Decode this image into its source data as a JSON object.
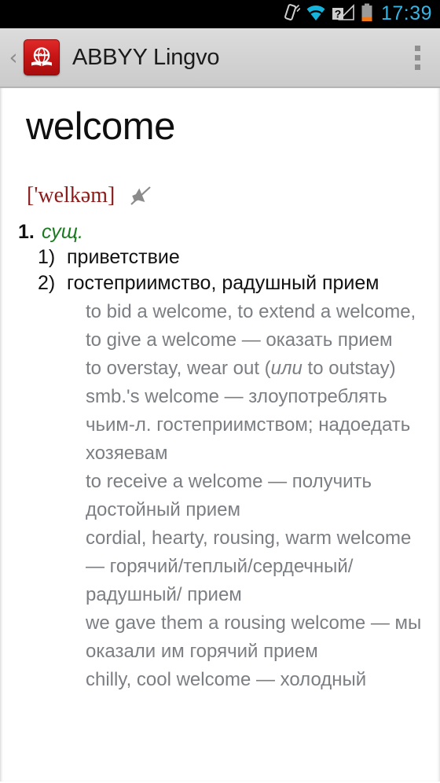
{
  "statusbar": {
    "time": "17:39",
    "icons": [
      {
        "name": "vibrate-icon",
        "label": "vibrate"
      },
      {
        "name": "wifi-icon",
        "label": "wifi"
      },
      {
        "name": "signal-unknown-icon",
        "label": "signal-unknown"
      },
      {
        "name": "battery-low-icon",
        "label": "battery-low"
      }
    ],
    "colors": {
      "background": "#000000",
      "clock": "#33b5e5",
      "battery_fill": "#f07818"
    }
  },
  "appbar": {
    "back_label": "‹",
    "app_icon_name": "abbyy-lingvo-globe-book-icon",
    "title": "ABBYY Lingvo",
    "overflow_label": "More options",
    "colors": {
      "background": "#d2d2d2",
      "icon_red": "#c81515",
      "title": "#1b1b1b"
    }
  },
  "article": {
    "headword": "welcome",
    "transcription": "['welkəm]",
    "transcription_color": "#8a1c1c",
    "sound_icon_name": "speaker-muted-icon",
    "pos_number": "1.",
    "pos_label": "сущ.",
    "pos_label_color": "#1a7a1f",
    "senses": [
      {
        "num": "1)",
        "text": "приветствие"
      },
      {
        "num": "2)",
        "text": "гостеприимство, радушный прием"
      }
    ],
    "examples": [
      {
        "pre": "to bid a welcome, to extend a welcome, to give a welcome — оказать прием",
        "italic": "",
        "post": ""
      },
      {
        "pre": "to overstay, wear out (",
        "italic": "или",
        "post": " to outstay) smb.'s welcome — злоупотреблять чьим-л. гостеприимством; надоедать хозяевам"
      },
      {
        "pre": "to receive a welcome — получить достойный прием",
        "italic": "",
        "post": ""
      },
      {
        "pre": "cordial, hearty, rousing, warm welcome — горячий/теплый/сердечный/радушный/ прием",
        "italic": "",
        "post": ""
      },
      {
        "pre": "we gave them a rousing welcome — мы оказали им горячий прием",
        "italic": "",
        "post": ""
      },
      {
        "pre": "chilly, cool welcome — холодный",
        "italic": "",
        "post": ""
      }
    ],
    "example_color": "#7b7f83"
  }
}
